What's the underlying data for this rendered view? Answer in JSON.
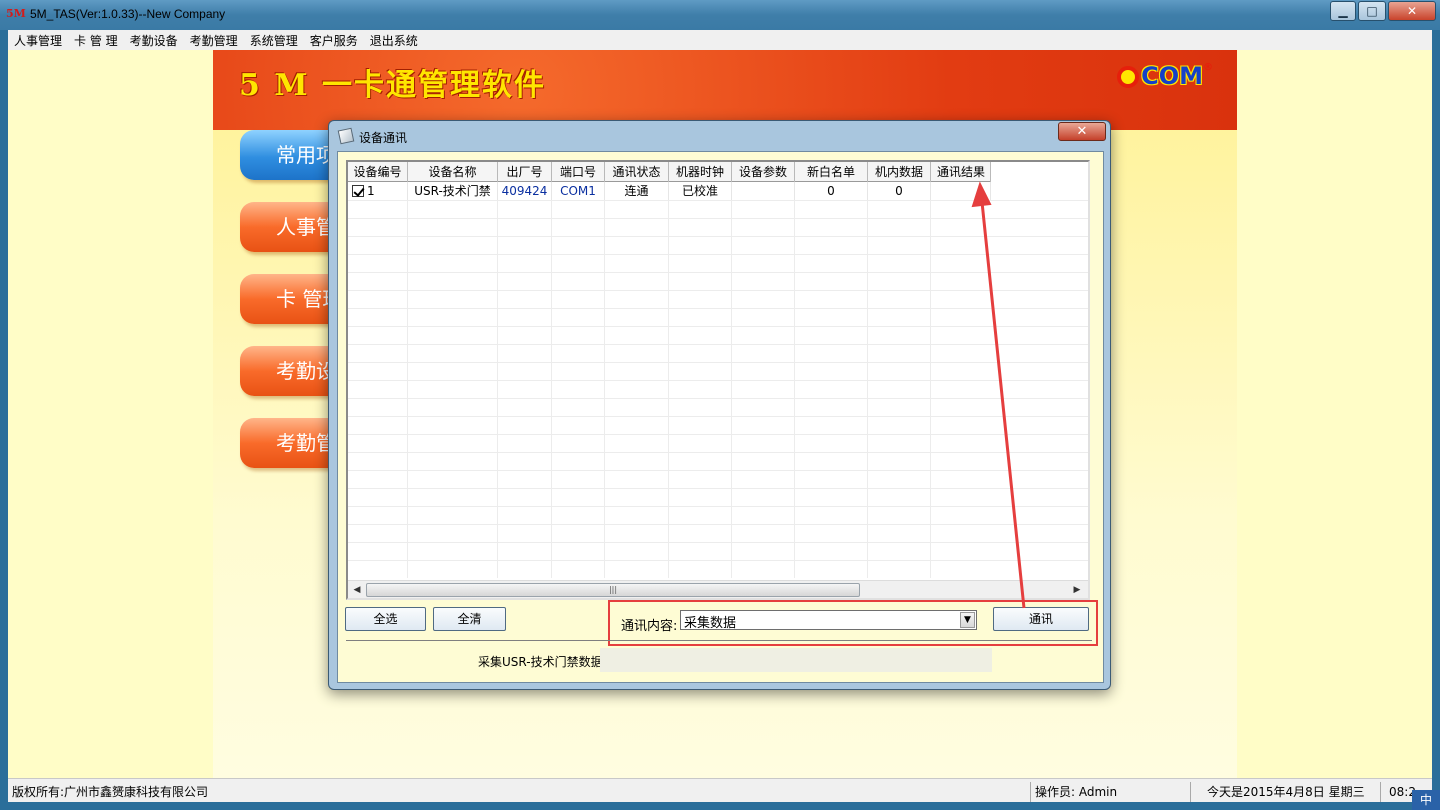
{
  "window": {
    "title": "5M_TAS(Ver:1.0.33)--New Company",
    "logo_text": "5M"
  },
  "menu": [
    "人事管理",
    "卡 管 理",
    "考勤设备",
    "考勤管理",
    "系统管理",
    "客户服务",
    "退出系统"
  ],
  "banner": {
    "title": "5 M 一卡通管理软件",
    "brand": "COM",
    "brand_reg": "®"
  },
  "sidebar": [
    {
      "label": "常用项",
      "active": true
    },
    {
      "label": "人事管理",
      "active": false
    },
    {
      "label": "卡 管理",
      "active": false
    },
    {
      "label": "考勤设备",
      "active": false
    },
    {
      "label": "考勤管理",
      "active": false
    }
  ],
  "dialog": {
    "title": "设备通讯",
    "close_glyph": "✕",
    "columns": [
      "设备编号",
      "设备名称",
      "出厂号",
      "端口号",
      "通讯状态",
      "机器时钟",
      "设备参数",
      "新白名单",
      "机内数据",
      "通讯结果"
    ],
    "rows": [
      {
        "checked": true,
        "cells": [
          "1",
          "USR-技术门禁",
          "409424",
          "COM1",
          "连通",
          "已校准",
          "",
          "0",
          "0",
          ""
        ]
      }
    ],
    "scroll_grip": "|||",
    "select_all_label": "全选",
    "clear_all_label": "全清",
    "content_label": "通讯内容:",
    "content_value": "采集数据",
    "communicate_label": "通讯",
    "status_text": "采集USR-技术门禁数据"
  },
  "statusbar": {
    "copyright": "版权所有:广州市鑫赟康科技有限公司",
    "operator": "操作员: Admin",
    "date": "今天是2015年4月8日 星期三",
    "time": "08:2"
  },
  "ime": "中",
  "colors": {
    "highlight": "#e53e3e",
    "arrow": "#e53e3e"
  }
}
